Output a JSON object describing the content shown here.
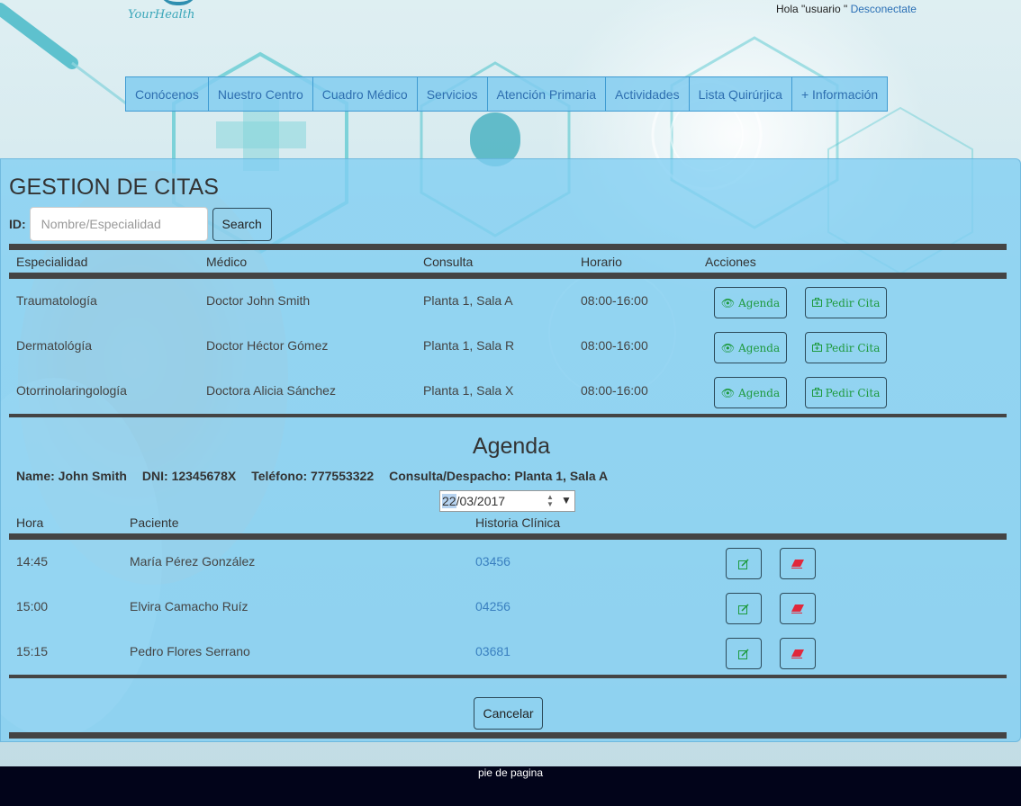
{
  "header": {
    "logo_text": "YourHealth",
    "greeting": "Hola \"usuario \"",
    "logout_label": "Desconectate"
  },
  "nav": {
    "items": [
      "Conócenos",
      "Nuestro Centro",
      "Cuadro Médico",
      "Servicios",
      "Atención Primaria",
      "Actividades",
      "Lista Quirúrjica",
      "+ Información"
    ]
  },
  "page": {
    "title": "GESTION DE CITAS",
    "id_label": "ID:",
    "search_placeholder": "Nombre/Especialidad",
    "search_button": "Search"
  },
  "doctors_table": {
    "headers": [
      "Especialidad",
      "Médico",
      "Consulta",
      "Horario",
      "Acciones"
    ],
    "rows": [
      {
        "especialidad": "Traumatología",
        "medico": "Doctor John Smith",
        "consulta": "Planta 1, Sala A",
        "horario": "08:00-16:00"
      },
      {
        "especialidad": "Dermatológía",
        "medico": "Doctor Héctor Gómez",
        "consulta": "Planta 1, Sala R",
        "horario": "08:00-16:00"
      },
      {
        "especialidad": "Otorrinolaringología",
        "medico": "Doctora Alicia Sánchez",
        "consulta": "Planta 1, Sala X",
        "horario": "08:00-16:00"
      }
    ],
    "agenda_label": "Agenda",
    "cita_label": "Pedir Cita"
  },
  "agenda": {
    "title": "Agenda",
    "name": "Name: John Smith",
    "dni": "DNI: 12345678X",
    "telefono": "Teléfono: 777553322",
    "consulta": "Consulta/Despacho: Planta 1, Sala A",
    "date_day": "22",
    "date_rest": "/03/2017",
    "headers": [
      "Hora",
      "Paciente",
      "Historia Clínica"
    ],
    "rows": [
      {
        "hora": "14:45",
        "paciente": "María Pérez González",
        "historia": "03456"
      },
      {
        "hora": "15:00",
        "paciente": "Elvira Camacho Ruíz",
        "historia": "04256"
      },
      {
        "hora": "15:15",
        "paciente": "Pedro Flores Serrano",
        "historia": "03681"
      }
    ],
    "cancel_label": "Cancelar"
  },
  "footer": {
    "text": "pie de pagina"
  },
  "colors": {
    "panel": "#80cef2",
    "nav_text": "#2e6fb0",
    "action_green": "#1e9a3e",
    "delete_red": "#e0283c",
    "footer_bg": "#02041a"
  }
}
